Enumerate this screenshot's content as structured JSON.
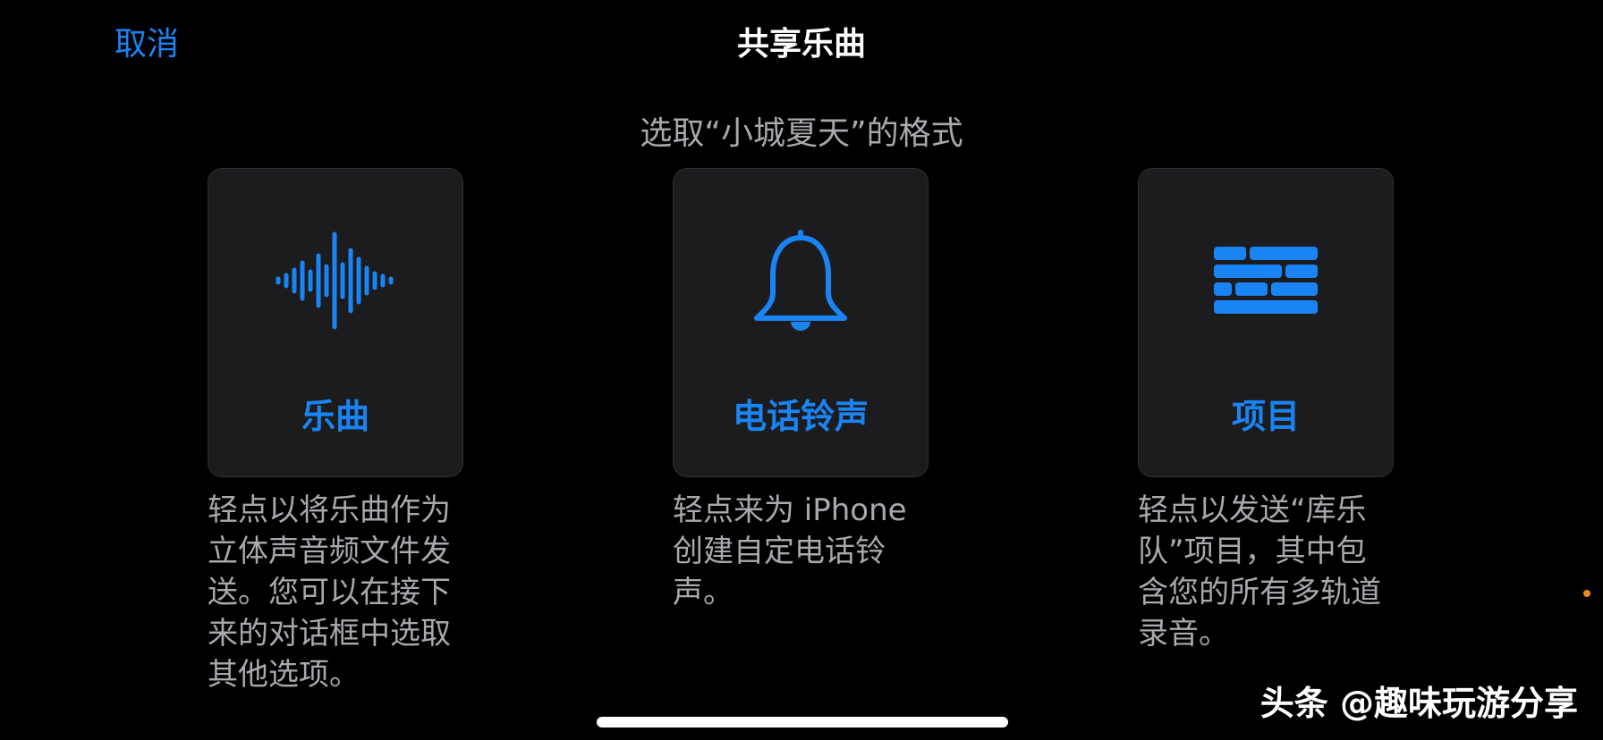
{
  "nav": {
    "cancel_label": "取消",
    "title": "共享乐曲"
  },
  "subtitle": "选取“小城夏天”的格式",
  "options": [
    {
      "label": "乐曲",
      "icon": "waveform-icon",
      "description": "轻点以将乐曲作为立体声音频文件发送。您可以在接下来的对话框中选取其他选项。"
    },
    {
      "label": "电话铃声",
      "icon": "bell-icon",
      "description": "轻点来为 iPhone 创建自定电话铃声。"
    },
    {
      "label": "项目",
      "icon": "project-bricks-icon",
      "description": "轻点以发送“库乐队”项目，其中包含您的所有多轨道录音。"
    }
  ],
  "watermark": "头条 @趣味玩游分享",
  "colors": {
    "accent": "#1a84f5",
    "background": "#000000",
    "card_background": "#1c1c1e",
    "secondary_text": "#a8a8ae",
    "indicator_dot": "#f08a1c"
  }
}
